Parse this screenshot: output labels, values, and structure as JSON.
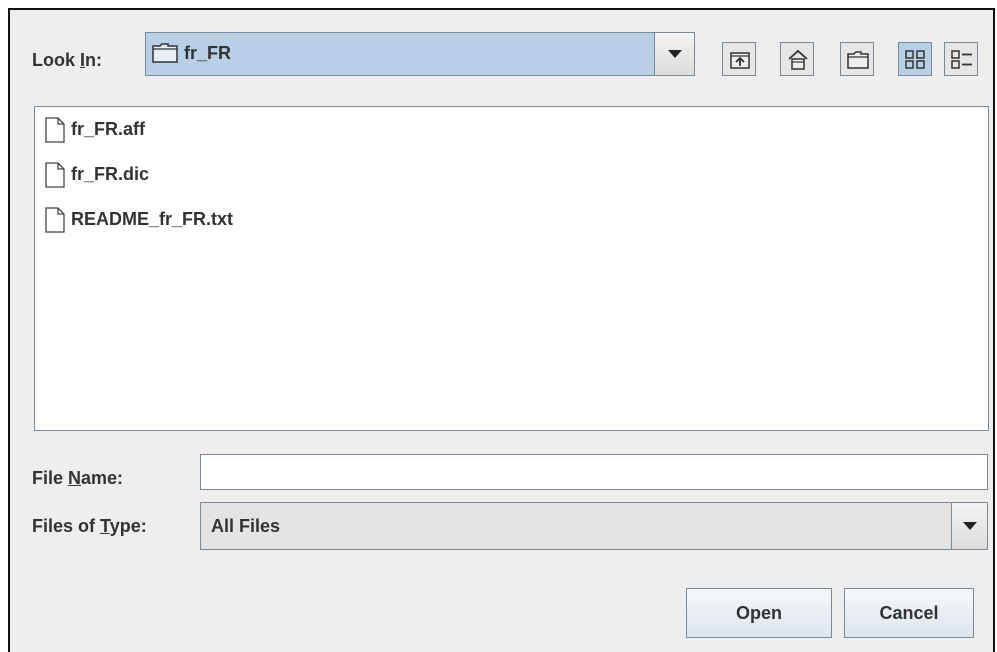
{
  "look_in": {
    "label_prefix": "Look ",
    "label_mnemonic": "I",
    "label_suffix": "n:",
    "selected": "fr_FR"
  },
  "toolbar": {
    "icons": [
      "up-folder-icon",
      "home-icon",
      "new-folder-icon",
      "list-view-icon",
      "details-view-icon"
    ]
  },
  "files": [
    {
      "name": "fr_FR.aff"
    },
    {
      "name": "fr_FR.dic"
    },
    {
      "name": "README_fr_FR.txt"
    }
  ],
  "file_name": {
    "label_prefix": "File ",
    "label_mnemonic": "N",
    "label_suffix": "ame:",
    "value": ""
  },
  "files_of_type": {
    "label_prefix": "Files of ",
    "label_mnemonic": "T",
    "label_suffix": "ype:",
    "selected": "All Files"
  },
  "buttons": {
    "open": "Open",
    "cancel": "Cancel"
  },
  "colors": {
    "selection": "#b8cfe5",
    "border": "#7a8a99",
    "panel": "#eeeeee"
  }
}
